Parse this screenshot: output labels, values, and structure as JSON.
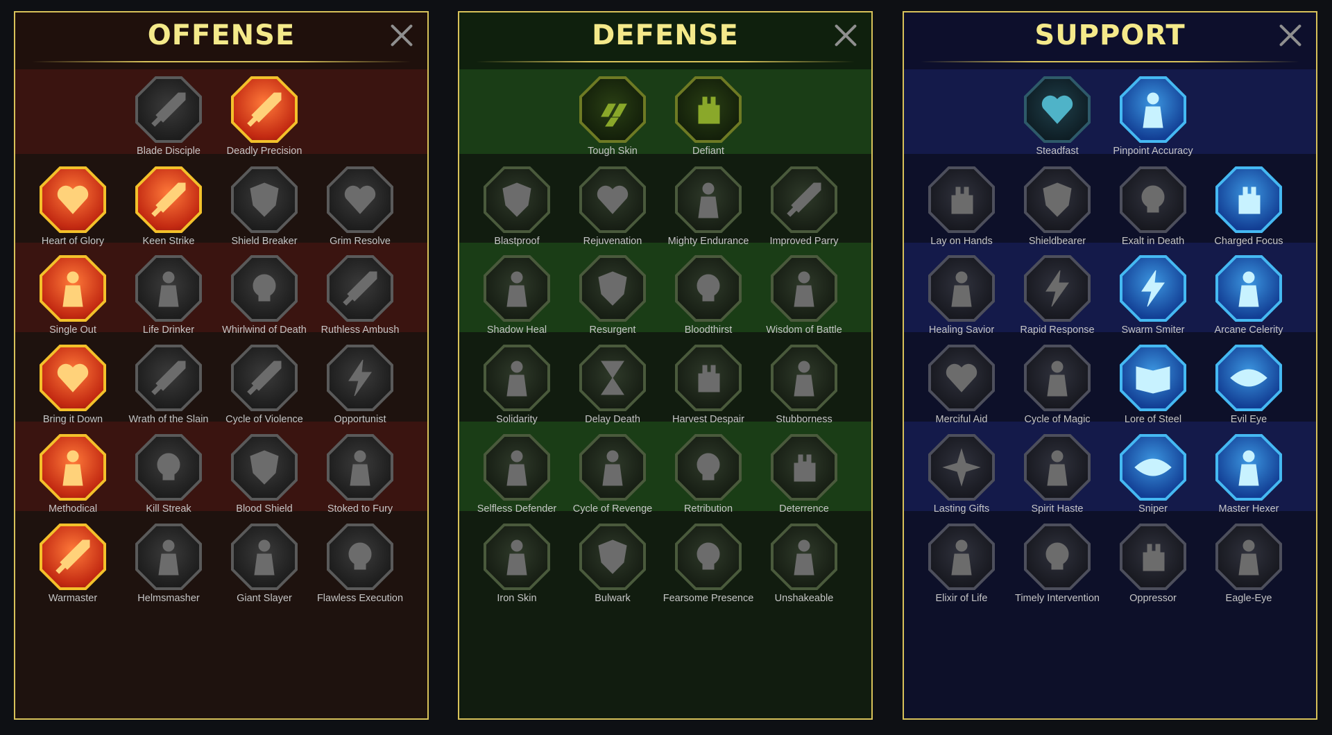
{
  "panels": [
    {
      "title": "OFFENSE",
      "rows": [
        [
          {
            "label": "Blade Disciple",
            "icon": "crossed-swords-icon",
            "state": "inactive"
          },
          {
            "label": "Deadly Precision",
            "icon": "dagger-slash-icon",
            "state": "active"
          }
        ],
        [
          {
            "label": "Heart of Glory",
            "icon": "horned-heart-icon",
            "state": "active"
          },
          {
            "label": "Keen Strike",
            "icon": "piercing-blade-icon",
            "state": "active"
          },
          {
            "label": "Shield Breaker",
            "icon": "broken-shield-icon",
            "state": "inactive"
          },
          {
            "label": "Grim Resolve",
            "icon": "spiked-heart-icon",
            "state": "inactive"
          }
        ],
        [
          {
            "label": "Single Out",
            "icon": "arrow-pierced-figure-icon",
            "state": "active"
          },
          {
            "label": "Life Drinker",
            "icon": "fangs-icon",
            "state": "inactive"
          },
          {
            "label": "Whirlwind of Death",
            "icon": "skull-whirl-icon",
            "state": "inactive"
          },
          {
            "label": "Ruthless Ambush",
            "icon": "hand-dagger-icon",
            "state": "inactive"
          }
        ],
        [
          {
            "label": "Bring it Down",
            "icon": "sword-heart-icon",
            "state": "active"
          },
          {
            "label": "Wrath of the Slain",
            "icon": "fist-blade-icon",
            "state": "inactive"
          },
          {
            "label": "Cycle of Violence",
            "icon": "axe-cycle-icon",
            "state": "inactive"
          },
          {
            "label": "Opportunist",
            "icon": "chain-lightning-icon",
            "state": "inactive"
          }
        ],
        [
          {
            "label": "Methodical",
            "icon": "arrows-target-icon",
            "state": "active"
          },
          {
            "label": "Kill Streak",
            "icon": "skulls-icon",
            "state": "inactive"
          },
          {
            "label": "Blood Shield",
            "icon": "sword-shield-icon",
            "state": "inactive"
          },
          {
            "label": "Stoked to Fury",
            "icon": "raging-figure-icon",
            "state": "inactive"
          }
        ],
        [
          {
            "label": "Warmaster",
            "icon": "sparkling-sword-icon",
            "state": "active"
          },
          {
            "label": "Helmsmasher",
            "icon": "helmet-icon",
            "state": "inactive"
          },
          {
            "label": "Giant Slayer",
            "icon": "giant-icon",
            "state": "inactive"
          },
          {
            "label": "Flawless Execution",
            "icon": "skull-burst-icon",
            "state": "inactive"
          }
        ]
      ]
    },
    {
      "title": "DEFENSE",
      "rows": [
        [
          {
            "label": "Tough Skin",
            "icon": "armor-plates-icon",
            "state": "active"
          },
          {
            "label": "Defiant",
            "icon": "raised-fist-icon",
            "state": "active"
          }
        ],
        [
          {
            "label": "Blastproof",
            "icon": "layered-shield-icon",
            "state": "inactive"
          },
          {
            "label": "Rejuvenation",
            "icon": "heart-organ-icon",
            "state": "inactive"
          },
          {
            "label": "Mighty Endurance",
            "icon": "strong-figure-icon",
            "state": "inactive"
          },
          {
            "label": "Improved Parry",
            "icon": "crossed-blades-icon",
            "state": "inactive"
          }
        ],
        [
          {
            "label": "Shadow Heal",
            "icon": "shadow-figure-icon",
            "state": "inactive"
          },
          {
            "label": "Resurgent",
            "icon": "knight-shield-icon",
            "state": "inactive"
          },
          {
            "label": "Bloodthirst",
            "icon": "skull-heart-icon",
            "state": "inactive"
          },
          {
            "label": "Wisdom of Battle",
            "icon": "monk-head-icon",
            "state": "inactive"
          }
        ],
        [
          {
            "label": "Solidarity",
            "icon": "group-figures-icon",
            "state": "inactive"
          },
          {
            "label": "Delay Death",
            "icon": "hourglass-icon",
            "state": "inactive"
          },
          {
            "label": "Harvest Despair",
            "icon": "open-hand-icon",
            "state": "inactive"
          },
          {
            "label": "Stubborness",
            "icon": "bull-head-icon",
            "state": "inactive"
          }
        ],
        [
          {
            "label": "Selfless Defender",
            "icon": "running-defender-icon",
            "state": "inactive"
          },
          {
            "label": "Cycle of Revenge",
            "icon": "blood-drops-icon",
            "state": "inactive"
          },
          {
            "label": "Retribution",
            "icon": "spiked-skull-icon",
            "state": "inactive"
          },
          {
            "label": "Deterrence",
            "icon": "deflect-hand-icon",
            "state": "inactive"
          }
        ],
        [
          {
            "label": "Iron Skin",
            "icon": "iron-figure-icon",
            "state": "inactive"
          },
          {
            "label": "Bulwark",
            "icon": "winged-shield-icon",
            "state": "inactive"
          },
          {
            "label": "Fearsome Presence",
            "icon": "hooded-skull-icon",
            "state": "inactive"
          },
          {
            "label": "Unshakeable",
            "icon": "flexing-figure-icon",
            "state": "inactive"
          }
        ]
      ]
    },
    {
      "title": "SUPPORT",
      "rows": [
        [
          {
            "label": "Steadfast",
            "icon": "heart-plus-icon",
            "state": "half"
          },
          {
            "label": "Pinpoint Accuracy",
            "icon": "target-swirl-icon",
            "state": "active"
          }
        ],
        [
          {
            "label": "Lay on Hands",
            "icon": "praying-hands-icon",
            "state": "inactive"
          },
          {
            "label": "Shieldbearer",
            "icon": "shield-aura-icon",
            "state": "inactive"
          },
          {
            "label": "Exalt in Death",
            "icon": "flaming-skull-icon",
            "state": "inactive"
          },
          {
            "label": "Charged Focus",
            "icon": "charged-hand-icon",
            "state": "active"
          }
        ],
        [
          {
            "label": "Healing Savior",
            "icon": "healing-figure-icon",
            "state": "inactive"
          },
          {
            "label": "Rapid Response",
            "icon": "lightning-bolt-icon",
            "state": "inactive"
          },
          {
            "label": "Swarm Smiter",
            "icon": "multi-lightning-icon",
            "state": "active"
          },
          {
            "label": "Arcane Celerity",
            "icon": "fast-figure-icon",
            "state": "active"
          }
        ],
        [
          {
            "label": "Merciful Aid",
            "icon": "chained-heart-icon",
            "state": "inactive"
          },
          {
            "label": "Cycle of Magic",
            "icon": "magic-comet-icon",
            "state": "inactive"
          },
          {
            "label": "Lore of Steel",
            "icon": "open-book-icon",
            "state": "active"
          },
          {
            "label": "Evil Eye",
            "icon": "evil-eyes-icon",
            "state": "active"
          }
        ],
        [
          {
            "label": "Lasting Gifts",
            "icon": "compass-star-icon",
            "state": "inactive"
          },
          {
            "label": "Spirit Haste",
            "icon": "winged-boot-icon",
            "state": "inactive"
          },
          {
            "label": "Sniper",
            "icon": "eye-icon",
            "state": "active"
          },
          {
            "label": "Master Hexer",
            "icon": "voodoo-doll-icon",
            "state": "active"
          }
        ],
        [
          {
            "label": "Elixir of Life",
            "icon": "potion-flask-icon",
            "state": "inactive"
          },
          {
            "label": "Timely Intervention",
            "icon": "winged-skull-icon",
            "state": "inactive"
          },
          {
            "label": "Oppressor",
            "icon": "crushing-fist-icon",
            "state": "inactive"
          },
          {
            "label": "Eagle-Eye",
            "icon": "eagle-head-icon",
            "state": "inactive"
          }
        ]
      ]
    }
  ]
}
